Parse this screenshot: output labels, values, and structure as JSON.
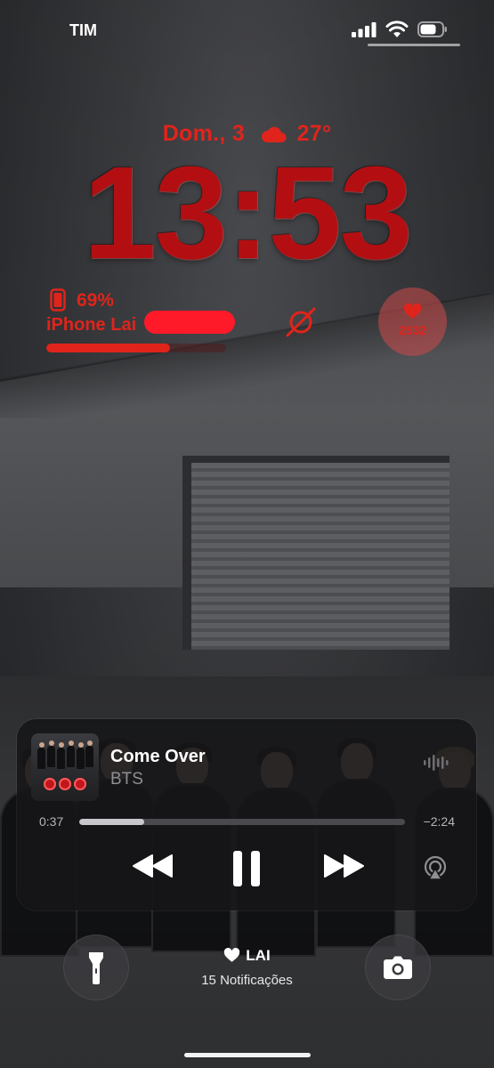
{
  "status_bar": {
    "carrier": "TIM"
  },
  "lock_screen": {
    "date": "Dom., 3",
    "weather_icon": "cloud-icon",
    "temperature": "27°",
    "time": "13:53"
  },
  "widgets": {
    "battery": {
      "icon": "iphone-icon",
      "percent_label": "69%",
      "level": 0.69,
      "device_name": "iPhone Lai"
    },
    "astronomy": {
      "icon": "astronomy-icon"
    },
    "fitness": {
      "icon": "heart-icon",
      "count": "2532"
    }
  },
  "now_playing": {
    "title": "Come Over",
    "artist": "BTS",
    "elapsed": "0:37",
    "remaining": "−2:24",
    "progress": 0.2,
    "controls": {
      "rewind": "rewind-icon",
      "pause": "pause-icon",
      "forward": "forward-icon",
      "airplay": "airplay-icon"
    }
  },
  "bottom": {
    "flashlight_icon": "flashlight-icon",
    "camera_icon": "camera-icon",
    "notification_owner": "LAI",
    "notification_count": "15 Notificações"
  },
  "colors": {
    "accent": "#e0241b",
    "clock": "#b30f12",
    "widget_bubble": "#cd4b4b"
  }
}
